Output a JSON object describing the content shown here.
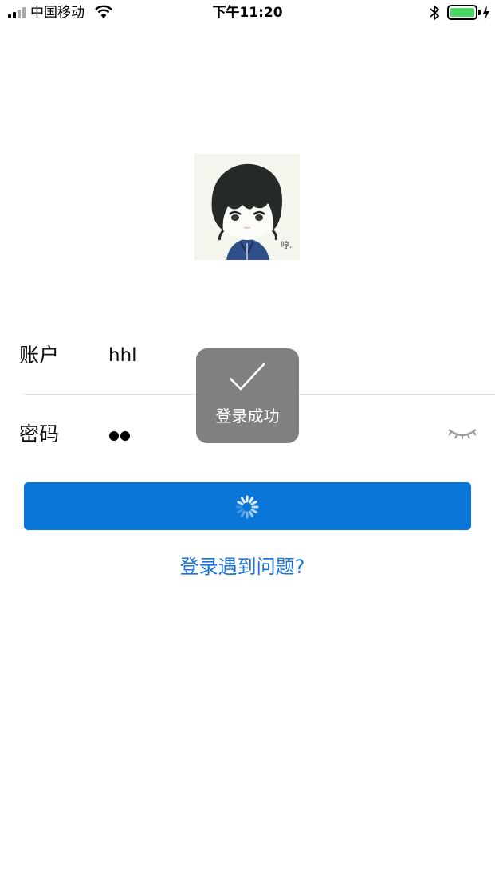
{
  "status_bar": {
    "carrier": "中国移动",
    "time": "下午11:20",
    "battery_color": "#4cd964"
  },
  "avatar": {
    "signature": "哼."
  },
  "form": {
    "account_label": "账户",
    "account_value": "hhl",
    "password_label": "密码",
    "password_masked_count": 2,
    "password_visibility_icon": "eye-closed-icon"
  },
  "login_button": {
    "state": "loading",
    "color": "#0a76d8"
  },
  "help_link": "登录遇到问题?",
  "toast": {
    "icon": "checkmark-icon",
    "text": "登录成功"
  }
}
